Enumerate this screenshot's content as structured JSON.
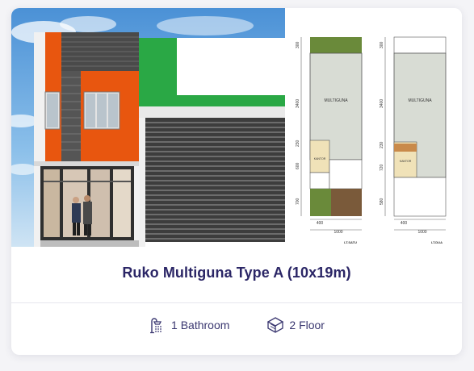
{
  "card": {
    "title": "Ruko Multiguna Type A (10x19m)",
    "photo_icon": "building-photo",
    "plan_icon": "floor-plan",
    "features": [
      {
        "icon": "shower-icon",
        "label": "1 Bathroom"
      },
      {
        "icon": "floor-layers-icon",
        "label": "2 Floor"
      }
    ]
  },
  "plan": {
    "left": {
      "room_main": "MULTIGUNA",
      "room_office": "KANTOR",
      "dims_vertical": [
        "300",
        "3400",
        "230",
        "600",
        "700"
      ],
      "dims_bottom": [
        "400",
        "1000"
      ],
      "caption": "LT.SATU"
    },
    "right": {
      "room_main": "MULTIGUNA",
      "room_office": "KANTOR",
      "dims_vertical": [
        "300",
        "3400",
        "230",
        "720",
        "580"
      ],
      "dims_bottom": [
        "400",
        "1000"
      ],
      "caption": "LT.DUA"
    }
  },
  "colors": {
    "accent_title": "#2b2666",
    "facade_orange": "#e8560f",
    "facade_green": "#2aa845",
    "plan_main_room": "#d8dcd4",
    "plan_office": "#f0e2b8"
  }
}
